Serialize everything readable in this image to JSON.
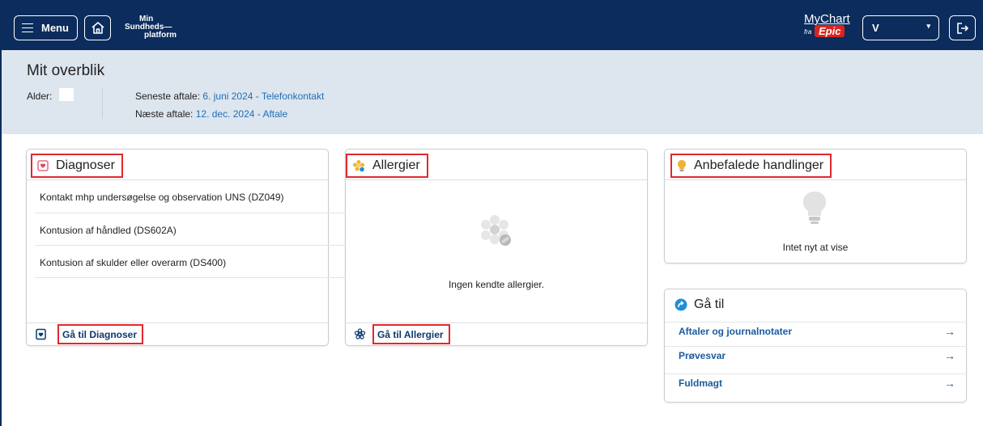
{
  "topbar": {
    "menu_label": "Menu",
    "platform_logo": [
      "Min",
      "Sundheds—",
      "platform"
    ],
    "mychart_logo": {
      "line1": "MyChart",
      "fra": "fra",
      "epic": "Epic"
    },
    "user_initial": "V",
    "colors": {
      "bar": "#0b2c5c"
    }
  },
  "overview": {
    "title": "Mit overblik",
    "age_label": "Alder:",
    "last_appt_label": "Seneste aftale:",
    "last_appt_value": "6. juni 2024 - Telefonkontakt",
    "next_appt_label": "Næste aftale:",
    "next_appt_value": "12. dec. 2024 - Aftale"
  },
  "diagnoses": {
    "title": "Diagnoser",
    "items": [
      "Kontakt mhp undersøgelse og observation UNS (DZ049)",
      "Kontusion af håndled (DS602A)",
      "Kontusion af skulder eller overarm (DS400)"
    ],
    "footer_link": "Gå til Diagnoser"
  },
  "allergies": {
    "title": "Allergier",
    "empty_text": "Ingen kendte allergier.",
    "footer_link": "Gå til Allergier"
  },
  "recommended": {
    "title": "Anbefalede handlinger",
    "empty_text": "Intet nyt at vise"
  },
  "goto": {
    "title": "Gå til",
    "links": [
      "Aftaler og journalnotater",
      "Prøvesvar",
      "Fuldmagt"
    ],
    "arrow": "→"
  },
  "accent": {
    "highlight": "#e0292f",
    "link": "#1f6fb8"
  }
}
